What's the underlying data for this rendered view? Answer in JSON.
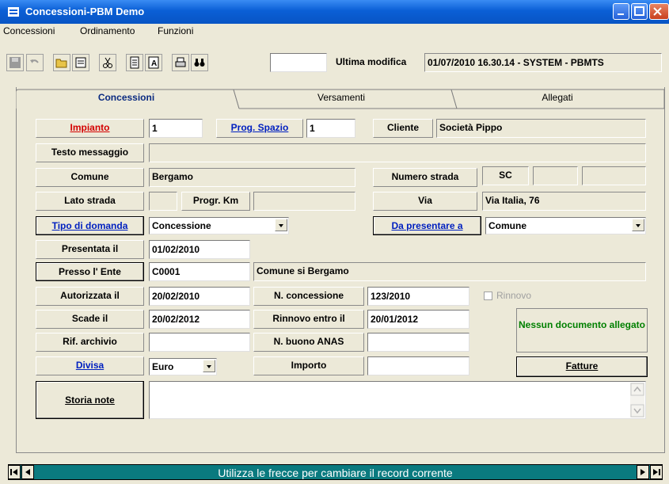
{
  "window": {
    "title": "Concessioni-PBM Demo"
  },
  "menu": [
    "Concessioni",
    "Ordinamento",
    "Funzioni"
  ],
  "toolbar": {
    "search_value": "",
    "last_modified_label": "Ultima modifica",
    "last_modified_value": "01/07/2010 16.30.14 - SYSTEM - PBMTS"
  },
  "tabs": [
    "Concessioni",
    "Versamenti",
    "Allegati"
  ],
  "form": {
    "impianto_label": "Impianto",
    "impianto_value": "1",
    "prog_spazio_label": "Prog. Spazio",
    "prog_spazio_value": "1",
    "cliente_label": "Cliente",
    "cliente_value": "Società Pippo",
    "testo_messaggio_label": "Testo messaggio",
    "testo_messaggio_value": "",
    "comune_label": "Comune",
    "comune_value": "Bergamo",
    "numero_strada_label": "Numero strada",
    "numero_strada_value1": "SC",
    "numero_strada_value2": "",
    "numero_strada_value3": "",
    "lato_strada_label": "Lato strada",
    "lato_strada_value": "",
    "progr_km_label": "Progr. Km",
    "progr_km_value": "",
    "via_label": "Via",
    "via_value": "Via Italia, 76",
    "tipo_domanda_label": "Tipo di domanda",
    "tipo_domanda_value": "Concessione",
    "da_presentare_label": "Da presentare a",
    "da_presentare_value": "Comune",
    "presentata_label": "Presentata il",
    "presentata_value": "01/02/2010",
    "presso_ente_label": "Presso l' Ente",
    "presso_ente_code": "C0001",
    "presso_ente_desc": "Comune si Bergamo",
    "autorizzata_label": "Autorizzata il",
    "autorizzata_value": "20/02/2010",
    "n_concessione_label": "N. concessione",
    "n_concessione_value": "123/2010",
    "rinnovo_label": "Rinnovo",
    "scade_label": "Scade il",
    "scade_value": "20/02/2012",
    "rinnovo_entro_label": "Rinnovo entro il",
    "rinnovo_entro_value": "20/01/2012",
    "rif_archivio_label": "Rif. archivio",
    "rif_archivio_value": "",
    "n_buono_label": "N. buono ANAS",
    "n_buono_value": "",
    "divisa_label": "Divisa",
    "divisa_value": "Euro",
    "importo_label": "Importo",
    "importo_value": "",
    "nessun_doc": "Nessun documento allegato",
    "fatture_label": "Fatture",
    "storia_note_label": "Storia note",
    "storia_note_value": ""
  },
  "status": {
    "message": "Utilizza le frecce per cambiare il record corrente"
  },
  "colors": {
    "title_blue": "#0A5FD6",
    "status_teal": "#0A7A7F",
    "link_red": "#D40000",
    "link_blue": "#0020C0",
    "doc_green": "#008000"
  }
}
